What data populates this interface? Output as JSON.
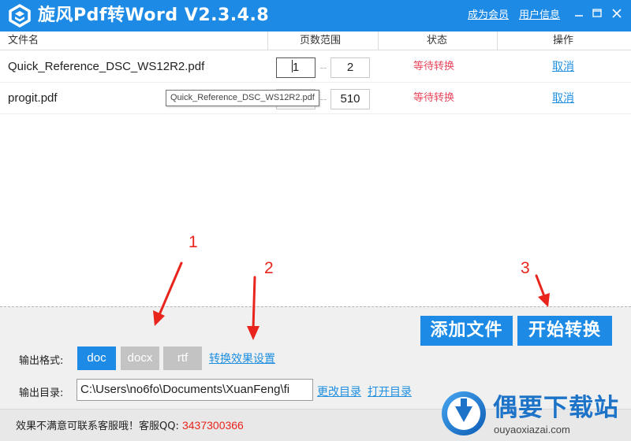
{
  "titlebar": {
    "app_title": "旋风Pdf转Word   V2.3.4.8",
    "become_member": "成为会员",
    "user_info": "用户信息",
    "bg_color": "#1d8be6"
  },
  "table": {
    "columns": [
      "文件名",
      "页数范围",
      "状态",
      "操作"
    ],
    "rows": [
      {
        "file_name": "Quick_Reference_DSC_WS12R2.pdf",
        "page_from": "1",
        "page_to": "2",
        "status": "等待转换",
        "action": "取消"
      },
      {
        "file_name": "progit.pdf",
        "page_from": "",
        "page_to": "510",
        "status": "等待转换",
        "action": "取消"
      }
    ],
    "tooltip": "Quick_Reference_DSC_WS12R2.pdf",
    "status_color": "#e8455b"
  },
  "annotations": [
    "1",
    "2",
    "3"
  ],
  "panel": {
    "add_files": "添加文件",
    "start_convert": "开始转换",
    "format_label": "输出格式:",
    "formats": [
      "doc",
      "docx",
      "rtf"
    ],
    "selected_format": "doc",
    "convert_settings": "转换效果设置",
    "dir_label": "输出目录:",
    "dir_value": "C:\\Users\\no6fo\\Documents\\XuanFeng\\fi",
    "change_dir": "更改目录",
    "open_dir": "打开目录"
  },
  "footer": {
    "text": "效果不满意可联系客服哦！客服QQ: ",
    "qq": "3437300366"
  },
  "watermark": {
    "title": "偶要下载站",
    "url": "ouyaoxiazai.com"
  }
}
